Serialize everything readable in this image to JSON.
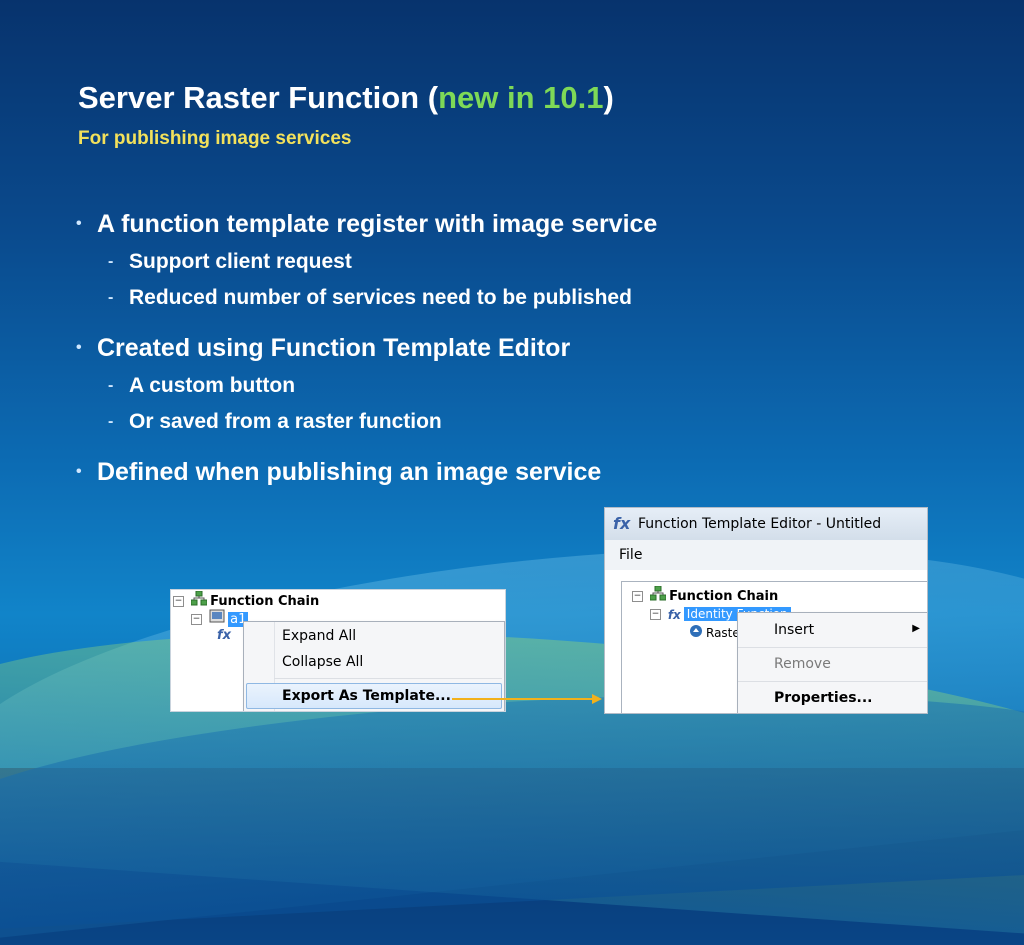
{
  "slide": {
    "title_main": "Server Raster Function",
    "title_open": "(",
    "title_highlight": "new in 10.1",
    "title_close": ")",
    "subtitle": "For publishing image services",
    "bullets": [
      {
        "text": "A function template register with image service",
        "sub": [
          "Support client request",
          "Reduced number of services need to be published"
        ]
      },
      {
        "text": "Created using Function Template Editor",
        "sub": [
          "A custom button",
          "Or saved from a raster function"
        ]
      },
      {
        "text": "Defined when publishing an image service",
        "sub": []
      }
    ],
    "sub_marker": "-"
  },
  "left_shot": {
    "tree_root": "Function Chain",
    "tree_child": "a1",
    "context_menu": [
      "Expand All",
      "Collapse All",
      "Export As Template..."
    ]
  },
  "right_shot": {
    "window_title": "Function Template Editor - Untitled",
    "menu_file": "File",
    "tree_root": "Function Chain",
    "tree_child": "Identity Function",
    "tree_grandchild": "Raster",
    "context_menu": [
      "Insert",
      "Remove",
      "Properties..."
    ]
  },
  "colors": {
    "title": "#ffffff",
    "highlight": "#7ed957",
    "subtitle": "#f3e15b",
    "arrow": "#f2b11b",
    "selection": "#3399ff"
  }
}
